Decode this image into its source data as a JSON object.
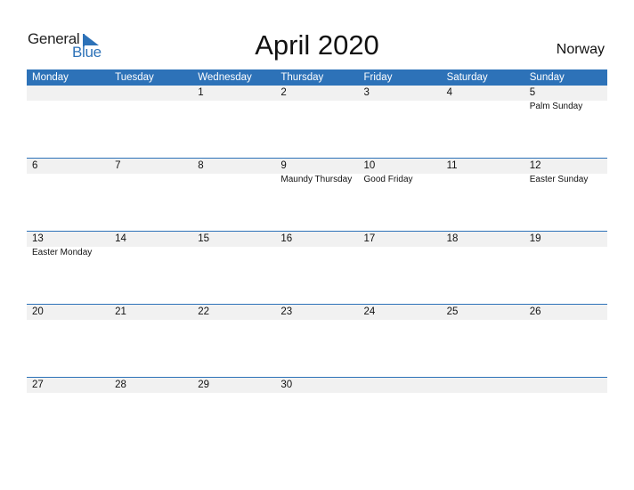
{
  "logo": {
    "line1": "General",
    "line2": "Blue"
  },
  "title": "April 2020",
  "country": "Norway",
  "weekdays": [
    "Monday",
    "Tuesday",
    "Wednesday",
    "Thursday",
    "Friday",
    "Saturday",
    "Sunday"
  ],
  "weeks": [
    {
      "days": [
        "",
        "",
        "1",
        "2",
        "3",
        "4",
        "5"
      ],
      "events": [
        "",
        "",
        "",
        "",
        "",
        "",
        "Palm Sunday"
      ]
    },
    {
      "days": [
        "6",
        "7",
        "8",
        "9",
        "10",
        "11",
        "12"
      ],
      "events": [
        "",
        "",
        "",
        "Maundy Thursday",
        "Good Friday",
        "",
        "Easter Sunday"
      ]
    },
    {
      "days": [
        "13",
        "14",
        "15",
        "16",
        "17",
        "18",
        "19"
      ],
      "events": [
        "Easter Monday",
        "",
        "",
        "",
        "",
        "",
        ""
      ]
    },
    {
      "days": [
        "20",
        "21",
        "22",
        "23",
        "24",
        "25",
        "26"
      ],
      "events": [
        "",
        "",
        "",
        "",
        "",
        "",
        ""
      ]
    },
    {
      "days": [
        "27",
        "28",
        "29",
        "30",
        "",
        "",
        ""
      ],
      "events": [
        "",
        "",
        "",
        "",
        "",
        "",
        ""
      ]
    }
  ],
  "colors": {
    "accent": "#2d72b8",
    "row_bg": "#f1f1f1"
  }
}
